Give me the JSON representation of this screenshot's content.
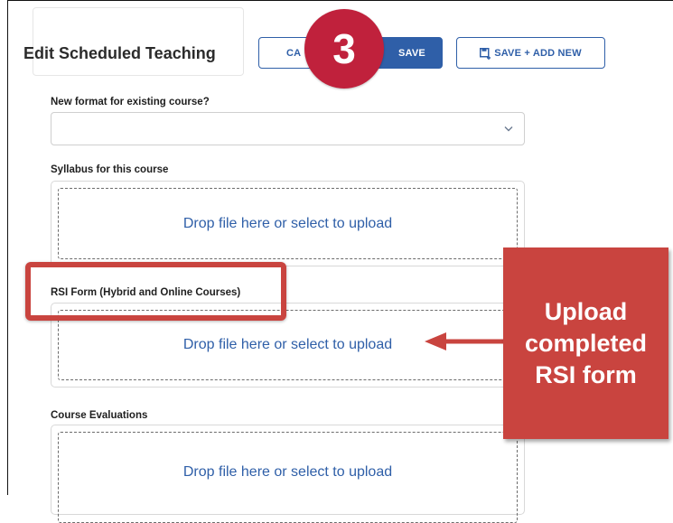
{
  "header": {
    "title": "Edit Scheduled Teaching",
    "cancel_label": "CA",
    "save_label": "SAVE",
    "save_add_label": "SAVE + ADD NEW"
  },
  "step_badge": "3",
  "fields": {
    "format_label": "New format for existing course?",
    "format_value": "",
    "syllabus_label": "Syllabus for this course",
    "syllabus_drop": "Drop file here or select to upload",
    "rsi_label": "RSI Form (Hybrid and Online Courses)",
    "rsi_drop": "Drop file here or select to upload",
    "evals_label": "Course Evaluations",
    "evals_drop": "Drop file here or select to upload"
  },
  "callout": {
    "line1": "Upload",
    "line2": "completed",
    "line3": "RSI form"
  },
  "colors": {
    "primary": "#2f5fa8",
    "annotation": "#c9443f",
    "badge": "#c0213c"
  }
}
